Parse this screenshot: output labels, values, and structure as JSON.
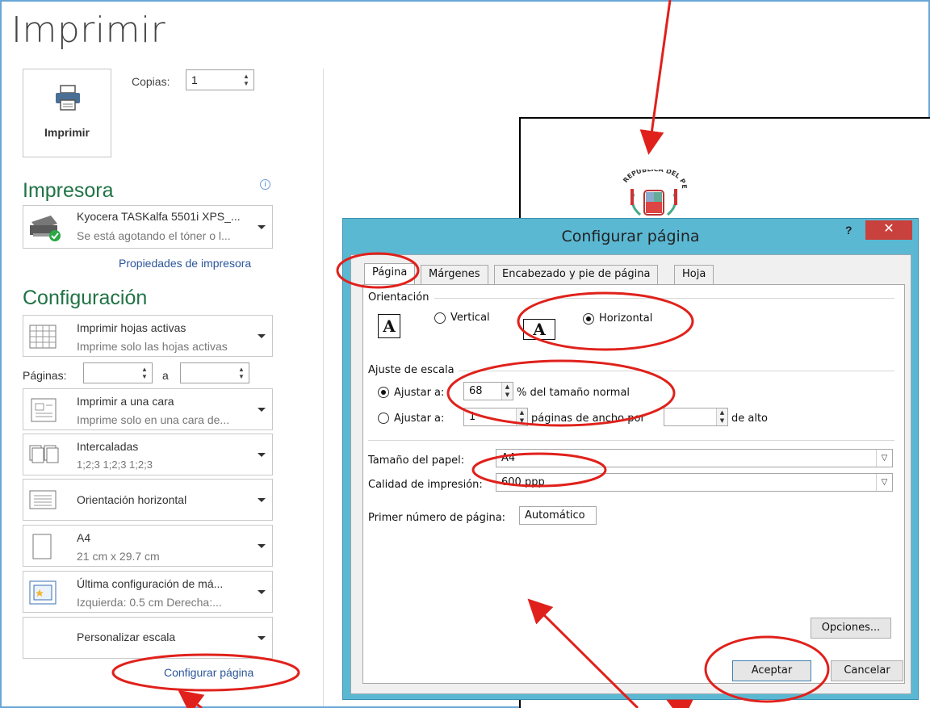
{
  "backstage": {
    "title": "Imprimir",
    "print_button": "Imprimir",
    "copies_label": "Copias:",
    "copies_value": "1"
  },
  "printer": {
    "section": "Impresora",
    "name": "Kyocera TASKalfa 5501i XPS_...",
    "status": "Se está agotando el tóner o l...",
    "properties_link": "Propiedades de impresora"
  },
  "settings": {
    "section": "Configuración",
    "print_what": {
      "title": "Imprimir hojas activas",
      "subtitle": "Imprime solo las hojas activas"
    },
    "pages_label": "Páginas:",
    "pages_to": "a",
    "sides": {
      "title": "Imprimir a una cara",
      "subtitle": "Imprime solo en una cara de..."
    },
    "collate": {
      "title": "Intercaladas",
      "subtitle": "1;2;3   1;2;3   1;2;3"
    },
    "orientation": "Orientación horizontal",
    "paper": {
      "title": "A4",
      "subtitle": "21 cm x 29.7 cm"
    },
    "margins": {
      "title": "Última configuración de má...",
      "subtitle": "Izquierda: 0.5 cm   Derecha:..."
    },
    "scaling": "Personalizar escala",
    "page_setup_link": "Configurar página"
  },
  "preview": {
    "emblem_text": "REPÚBLICA DEL PERÚ"
  },
  "dialog": {
    "title": "Configurar página",
    "help": "?",
    "close": "✕",
    "tabs": [
      "Página",
      "Márgenes",
      "Encabezado y pie de página",
      "Hoja"
    ],
    "orientation_label": "Orientación",
    "vertical": "Vertical",
    "horizontal": "Horizontal",
    "scale_label": "Ajuste de escala",
    "adjust_to": "Ajustar a:",
    "adjust_value": "68",
    "adjust_suffix": "% del tamaño normal",
    "fit_to": "Ajustar a:",
    "fit_wide_value": "1",
    "fit_wide_suffix": "páginas de ancho por",
    "fit_tall_value": "",
    "fit_tall_suffix": "de alto",
    "paper_size_label": "Tamaño del papel:",
    "paper_size_value": "A4",
    "quality_label": "Calidad de impresión:",
    "quality_value": "600 ppp",
    "first_page_label": "Primer número de página:",
    "first_page_value": "Automático",
    "options_button": "Opciones...",
    "ok_button": "Aceptar",
    "cancel_button": "Cancelar"
  },
  "colors": {
    "accent_green": "#217346",
    "dialog_frame": "#5bb8d3",
    "close_red": "#c9413c",
    "annotation_red": "#e0211b",
    "link_blue": "#2a5699"
  }
}
